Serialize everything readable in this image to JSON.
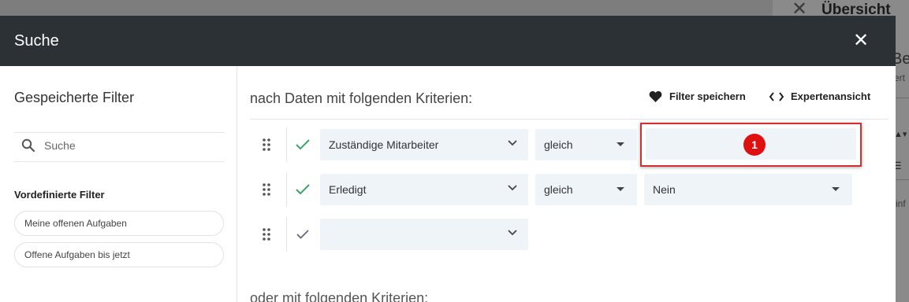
{
  "background": {
    "close_glyph": "✕",
    "title": "Übersicht",
    "fragment_be": "Be",
    "fragment_ert": "ert",
    "fragment_inf": "inf"
  },
  "modal": {
    "title": "Suche",
    "close_glyph": "✕"
  },
  "sidebar": {
    "title": "Gespeicherte Filter",
    "search_placeholder": "Suche",
    "predefined_title": "Vordefinierte Filter",
    "predefined": [
      {
        "label": "Meine offenen Aufgaben"
      },
      {
        "label": "Offene Aufgaben bis jetzt"
      }
    ]
  },
  "main": {
    "criteria_title": "nach Daten mit folgenden Kriterien:",
    "save_filter_label": "Filter speichern",
    "expert_view_label": "Expertenansicht",
    "or_title": "oder mit folgenden Kriterien:",
    "rows": [
      {
        "field": "Zuständige Mitarbeiter",
        "operator": "gleich",
        "value": "",
        "highlight_badge": "1"
      },
      {
        "field": "Erledigt",
        "operator": "gleich",
        "value": "Nein"
      },
      {
        "field": "",
        "operator": null,
        "value": null
      }
    ]
  },
  "colors": {
    "header_bg": "#2b3135",
    "field_bg": "#eef4f8",
    "check": "#3aa36a",
    "highlight": "#d32f2f",
    "badge": "#e01010"
  }
}
